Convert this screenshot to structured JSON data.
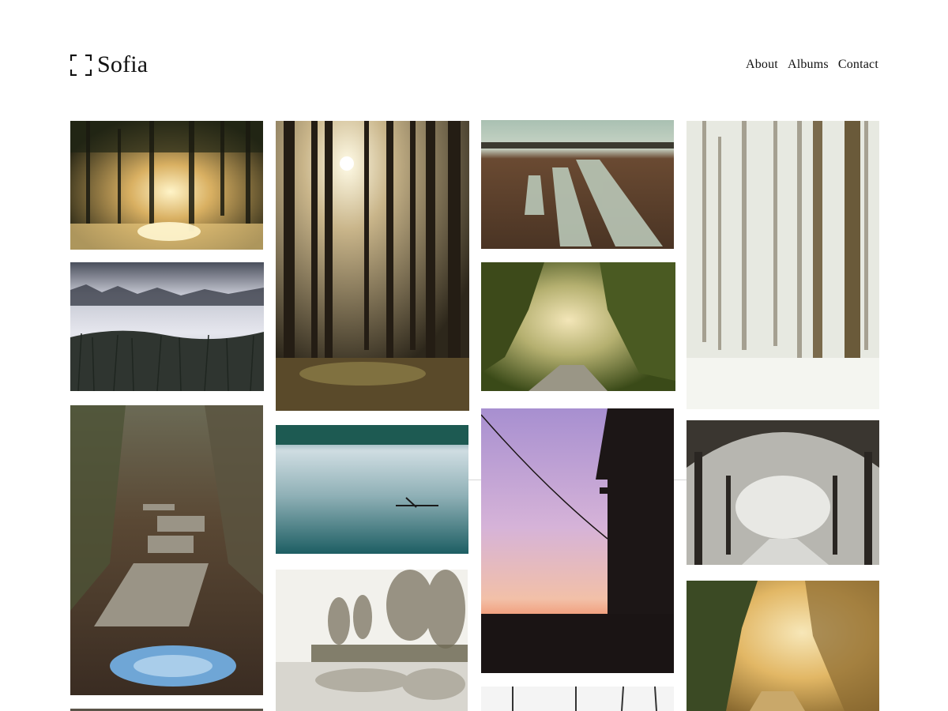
{
  "site": {
    "title": "Sofia",
    "logo_icon": "viewfinder-bracket-icon"
  },
  "nav": {
    "items": [
      {
        "label": "About"
      },
      {
        "label": "Albums"
      },
      {
        "label": "Contact"
      }
    ]
  },
  "gallery": {
    "photos": [
      {
        "subject": "sunbeams through misty forest over water",
        "palette": [
          "#2a2a18",
          "#c9a45a",
          "#f5e1a0"
        ]
      },
      {
        "subject": "misty lake with reeds",
        "palette": [
          "#b9bcc8",
          "#3a3f48",
          "#e8e9ee"
        ]
      },
      {
        "subject": "wooden boardwalk on forest path",
        "palette": [
          "#4a3a2a",
          "#8a7a66",
          "#6fa6d6"
        ]
      },
      {
        "subject": "sun through tall pine forest",
        "palette": [
          "#2b2418",
          "#b8a27a",
          "#fbf4d8"
        ]
      },
      {
        "subject": "fog over teal lake",
        "palette": [
          "#1f5a66",
          "#c9d6dc",
          "#2e6f75"
        ]
      },
      {
        "subject": "foggy trees on lake shore",
        "palette": [
          "#f2f2f0",
          "#6a6452",
          "#a8a090"
        ]
      },
      {
        "subject": "flooded field with tire tracks",
        "palette": [
          "#6a4a30",
          "#9fb2a0",
          "#c8d4c4"
        ]
      },
      {
        "subject": "road through autumn forest",
        "palette": [
          "#4a5a22",
          "#e8d89a",
          "#8a8a6a"
        ]
      },
      {
        "subject": "house silhouette at purple sunset",
        "palette": [
          "#b9a3d6",
          "#f0b39a",
          "#1a1414"
        ]
      },
      {
        "subject": "bare trees against white sky",
        "palette": [
          "#f4f4f4",
          "#333333",
          "#888888"
        ]
      },
      {
        "subject": "snowy birch forest",
        "palette": [
          "#e9ebe4",
          "#6a5a3a",
          "#c9ccc0"
        ]
      },
      {
        "subject": "snowy tree arch over road",
        "palette": [
          "#3a3630",
          "#d8d8d4",
          "#8a8680"
        ]
      },
      {
        "subject": "golden misty forest",
        "palette": [
          "#3a4a22",
          "#e8c070",
          "#f6e3b0"
        ]
      }
    ]
  }
}
